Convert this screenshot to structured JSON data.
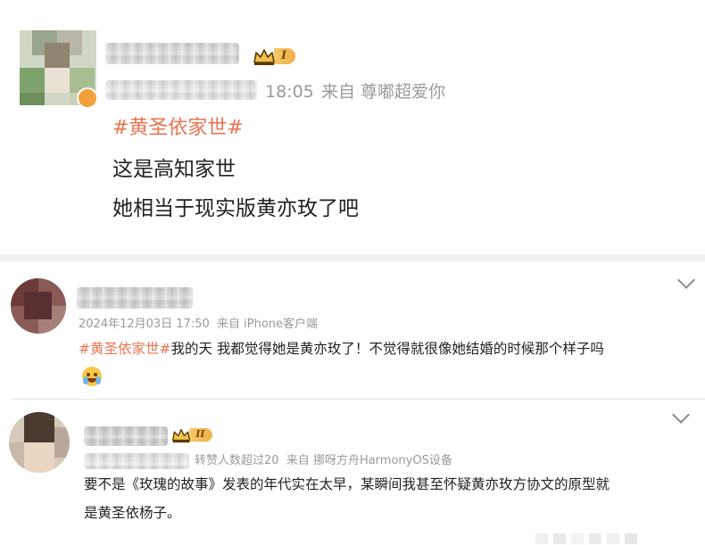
{
  "post": {
    "time": "18:05",
    "source": "来自 尊嘟超爱你",
    "level": "I",
    "topic": "#黄圣依家世#",
    "lines": [
      "这是高知家世",
      "她相当于现实版黄亦玫了吧"
    ]
  },
  "comments": [
    {
      "meta": "2024年12月03日 17:50  来自 iPhone客户端",
      "topic": "#黄圣依家世#",
      "text": "我的天 我都觉得她是黄亦玫了！不觉得就很像她结婚的时候那个样子吗",
      "emoji": "crying-face"
    },
    {
      "level": "II",
      "meta": "转赞人数超过20  来自 挪呀方舟HarmonyOS设备",
      "text_line1": "要不是《玫瑰的故事》发表的年代实在太早，某瞬间我甚至怀疑黄亦玫方协文的原型就",
      "text_line2": "是黄圣依杨子。"
    }
  ],
  "colors": {
    "topic": "#eb7350",
    "meta": "#9a9a9a",
    "text": "#333333",
    "badge": "#f0b14a"
  }
}
